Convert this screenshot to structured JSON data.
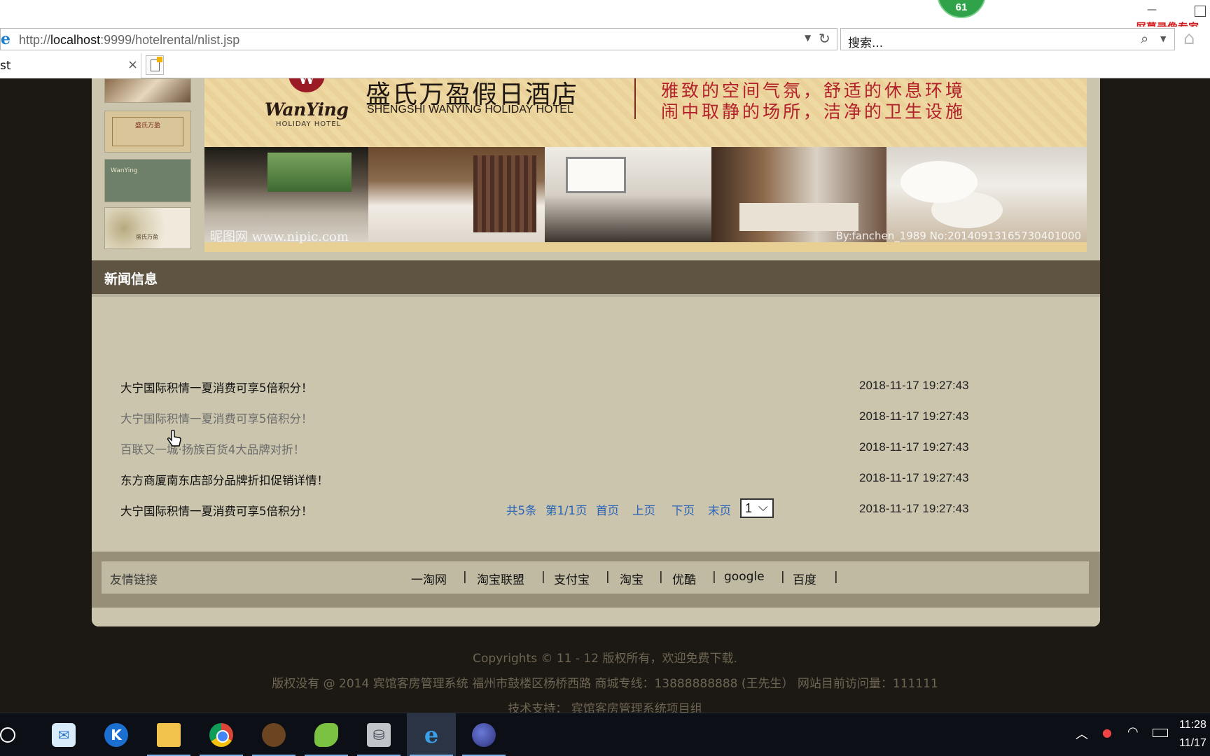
{
  "browser": {
    "url_host": "localhost",
    "url_prefix": "http://",
    "url_suffix": ":9999/hotelrental/nlist.jsp",
    "search_placeholder": "搜索...",
    "tab_title": "st",
    "tab_close": "×",
    "badge_count": "61",
    "recorder_label": "屏幕录像专家"
  },
  "banner": {
    "logo_mark": "W",
    "logo_en": "WanYing",
    "logo_sub": "HOLIDAY HOTEL",
    "hotel_cn": "盛氏万盈假日酒店",
    "hotel_en": "SHENGSHI WANYING HOLIDAY HOTEL",
    "slogan_1": "雅致的空间气氛，舒适的休息环境",
    "slogan_2": "闹中取静的场所，洁净的卫生设施",
    "watermark_left": "昵图网 www.nipic.com",
    "watermark_right": "By:fanchen_1989 No:20140913165730401000"
  },
  "news": {
    "section_title": "新闻信息",
    "items": [
      {
        "title": "大宁国际积情一夏消费可享5倍积分！",
        "date": "2018-11-17 19:27:43",
        "visited": false
      },
      {
        "title": "大宁国际积情一夏消费可享5倍积分！",
        "date": "2018-11-17 19:27:43",
        "visited": true
      },
      {
        "title": "百联又一城·扬族百货4大品牌对折！",
        "date": "2018-11-17 19:27:43",
        "visited": true
      },
      {
        "title": "东方商厦南东店部分品牌折扣促销详情！",
        "date": "2018-11-17 19:27:43",
        "visited": false
      },
      {
        "title": "大宁国际积情一夏消费可享5倍积分！",
        "date": "2018-11-17 19:27:43",
        "visited": false
      }
    ]
  },
  "pager": {
    "total": "共5条",
    "page": "第1/1页",
    "first": "首页",
    "prev": "上页",
    "next": "下页",
    "last": "末页",
    "selected": "1"
  },
  "links": {
    "label": "友情链接",
    "items": [
      "一淘网",
      "淘宝联盟",
      "支付宝",
      "淘宝",
      "优酷",
      "google",
      "百度"
    ],
    "separator": "|"
  },
  "footer": {
    "copyright": "Copyrights © 11 - 12 版权所有，欢迎免费下载.",
    "info": "版权没有 @ 2014 宾馆客房管理系统 福州市鼓楼区杨桥西路 商城专线：13888888888 (王先生）    网站目前访问量：111111",
    "support": "技术支持： 宾馆客房管理系统项目组"
  },
  "taskbar": {
    "apps": [
      "mail-app",
      "k-app",
      "file-explorer",
      "chrome",
      "game-app",
      "leaf-app",
      "database-tool",
      "internet-explorer",
      "eclipse"
    ],
    "clock_time": "11:28",
    "clock_date": "11/17"
  },
  "colors": {
    "page_bg": "#1c1814",
    "content_bg": "#cbc5ad",
    "section_header": "#5e5441",
    "pager_link": "#2963b8"
  }
}
